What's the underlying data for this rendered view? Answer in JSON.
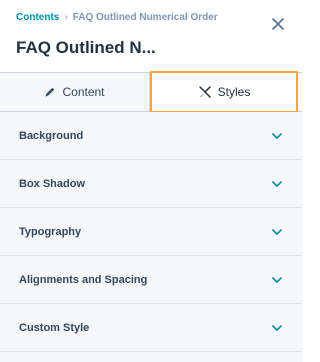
{
  "header": {
    "breadcrumb_root": "Contents",
    "breadcrumb_separator": "›",
    "breadcrumb_current": "FAQ Outlined Numerical Order",
    "title": "FAQ Outlined N..."
  },
  "tabs": [
    {
      "label": "Content",
      "icon": "pencil-icon",
      "active": false
    },
    {
      "label": "Styles",
      "icon": "brush-icon",
      "active": true
    }
  ],
  "sections": [
    {
      "label": "Background"
    },
    {
      "label": "Box Shadow"
    },
    {
      "label": "Typography"
    },
    {
      "label": "Alignments and Spacing"
    },
    {
      "label": "Custom Style"
    }
  ],
  "colors": {
    "link": "#0091ae",
    "chevron": "#0091ae",
    "active_tab_outline": "#f5a447",
    "panel_bg": "#f5f8fa"
  }
}
